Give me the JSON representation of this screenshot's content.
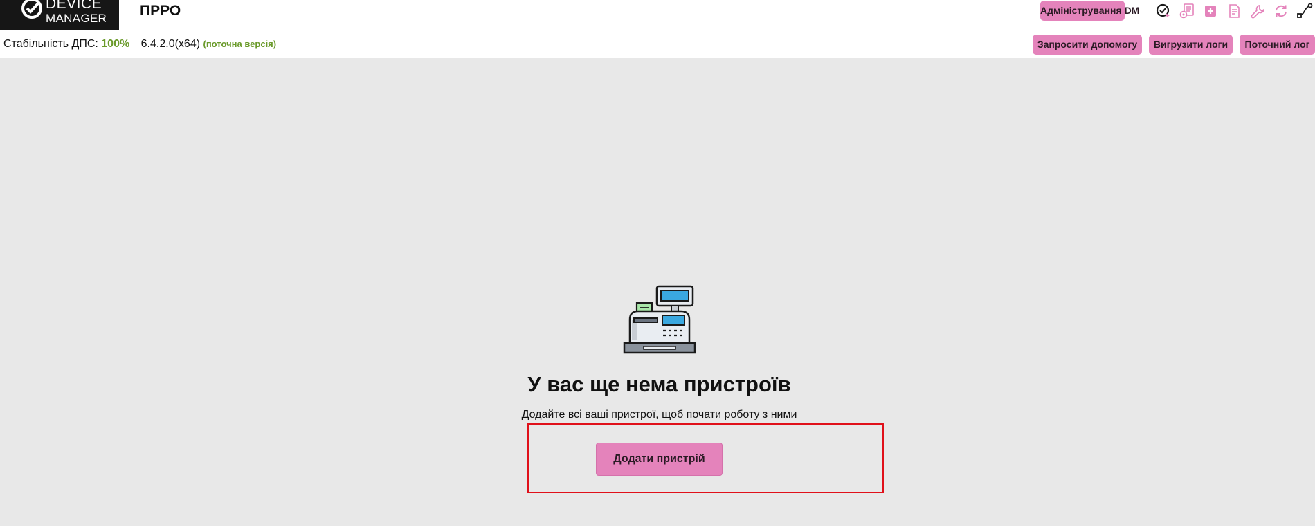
{
  "header": {
    "logo_line1": "DEVICE",
    "logo_line2": "MANAGER",
    "app_title": "ПРРО",
    "admin_button": "Адміністрування DM"
  },
  "toolbar_icons": [
    "sync-status-icon",
    "receipt-settings-icon",
    "add-icon",
    "document-icon",
    "wrench-icon",
    "refresh-icon",
    "connection-icon"
  ],
  "status_bar": {
    "label": "Стабільність ДПС:",
    "stability_value": "100%",
    "version": "6.4.2.0(x64)",
    "version_note": "(поточна версія)",
    "help_button": "Запросити допомогу",
    "upload_logs_button": "Вигрузити логи",
    "current_log_button": "Поточний лог"
  },
  "empty_state": {
    "illustration": "cash-register-icon",
    "title": "У вас ще нема пристроїв",
    "subtitle": "Додайте всі ваші пристрої, щоб почати роботу з ними",
    "add_button": "Додати пристрій"
  },
  "colors": {
    "accent_pink": "#e483bb",
    "success_green": "#6a9a2a",
    "highlight_red": "#e0101a",
    "main_background": "#e8e8e8"
  }
}
